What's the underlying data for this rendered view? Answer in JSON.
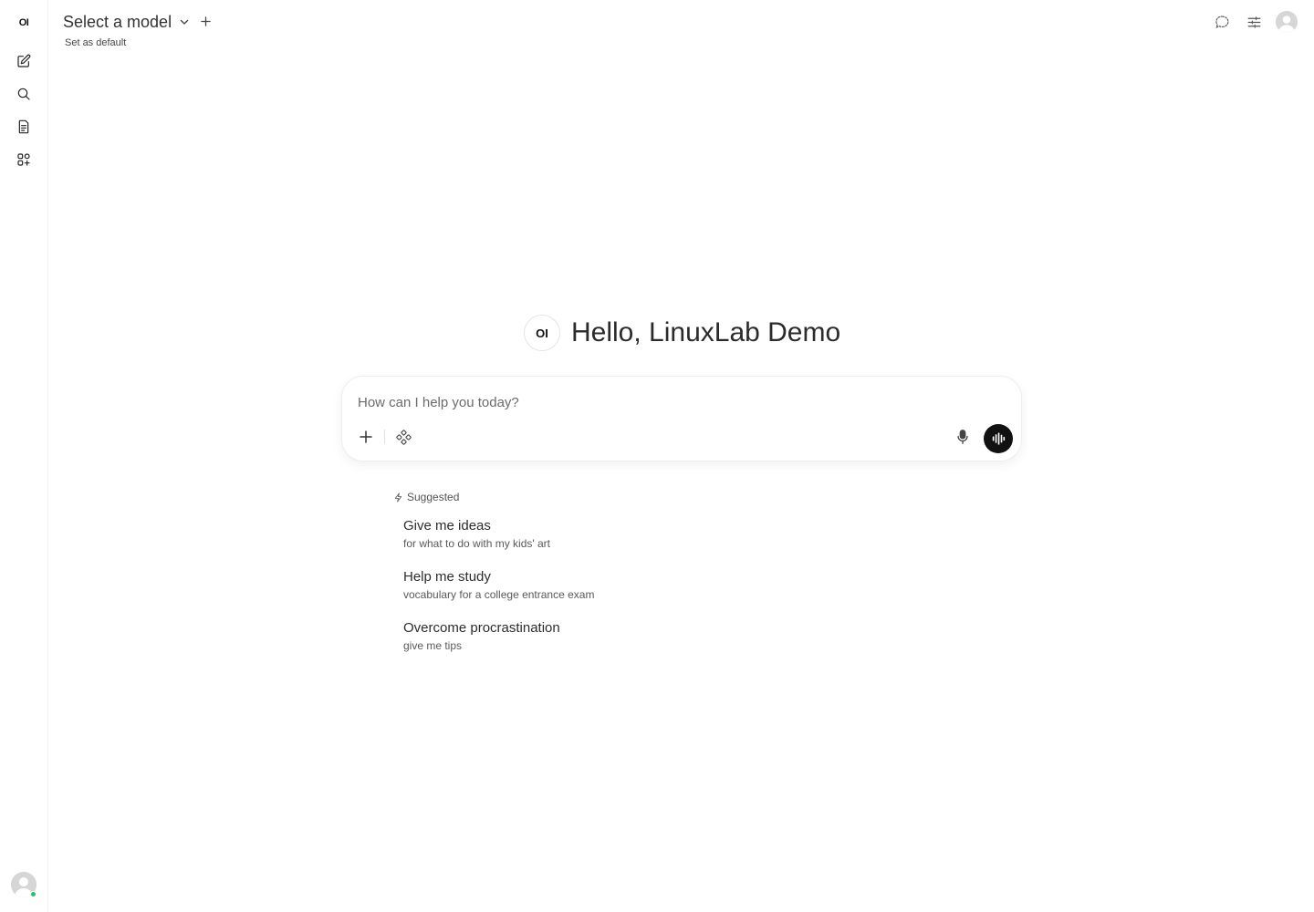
{
  "sidebar": {
    "logo_text": "OI",
    "items": [
      {
        "name": "new-chat",
        "icon": "pencil-square-icon"
      },
      {
        "name": "search",
        "icon": "search-icon"
      },
      {
        "name": "notes",
        "icon": "document-icon"
      },
      {
        "name": "workspace",
        "icon": "apps-plus-icon"
      }
    ],
    "status_color": "#22c55e"
  },
  "header": {
    "model_select_label": "Select a model",
    "set_default_label": "Set as default"
  },
  "main": {
    "model_logo_text": "OI",
    "greeting": "Hello, LinuxLab Demo"
  },
  "chat_input": {
    "placeholder": "How can I help you today?",
    "value": ""
  },
  "suggestions": {
    "heading": "Suggested",
    "items": [
      {
        "title": "Give me ideas",
        "subtitle": "for what to do with my kids' art"
      },
      {
        "title": "Help me study",
        "subtitle": "vocabulary for a college entrance exam"
      },
      {
        "title": "Overcome procrastination",
        "subtitle": "give me tips"
      }
    ]
  }
}
